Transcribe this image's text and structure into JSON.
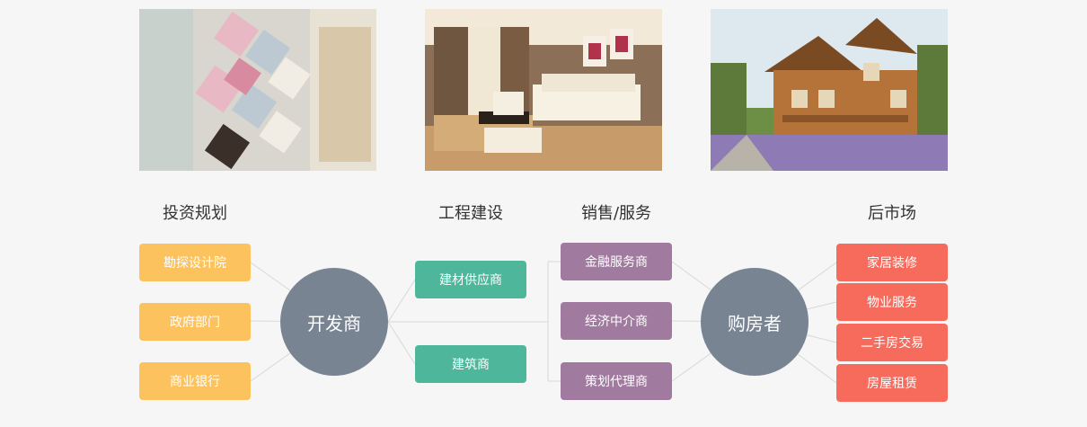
{
  "photos": [
    {
      "name": "tiles-photo"
    },
    {
      "name": "living-room-photo"
    },
    {
      "name": "wooden-house-photo"
    }
  ],
  "headings": {
    "investment": "投资规划",
    "construction": "工程建设",
    "sales": "销售/服务",
    "aftermarket": "后市场"
  },
  "investment_items": [
    "勘探设计院",
    "政府部门",
    "商业银行"
  ],
  "developer": "开发商",
  "construction_items": [
    "建材供应商",
    "建筑商"
  ],
  "sales_items": [
    "金融服务商",
    "经济中介商",
    "策划代理商"
  ],
  "buyer": "购房者",
  "aftermarket_items": [
    "家居装修",
    "物业服务",
    "二手房交易",
    "房屋租赁"
  ],
  "colors": {
    "investment": "#fcc25d",
    "construction": "#4eb69a",
    "sales": "#a17a9f",
    "aftermarket": "#f76b5c",
    "hub": "#788492"
  }
}
